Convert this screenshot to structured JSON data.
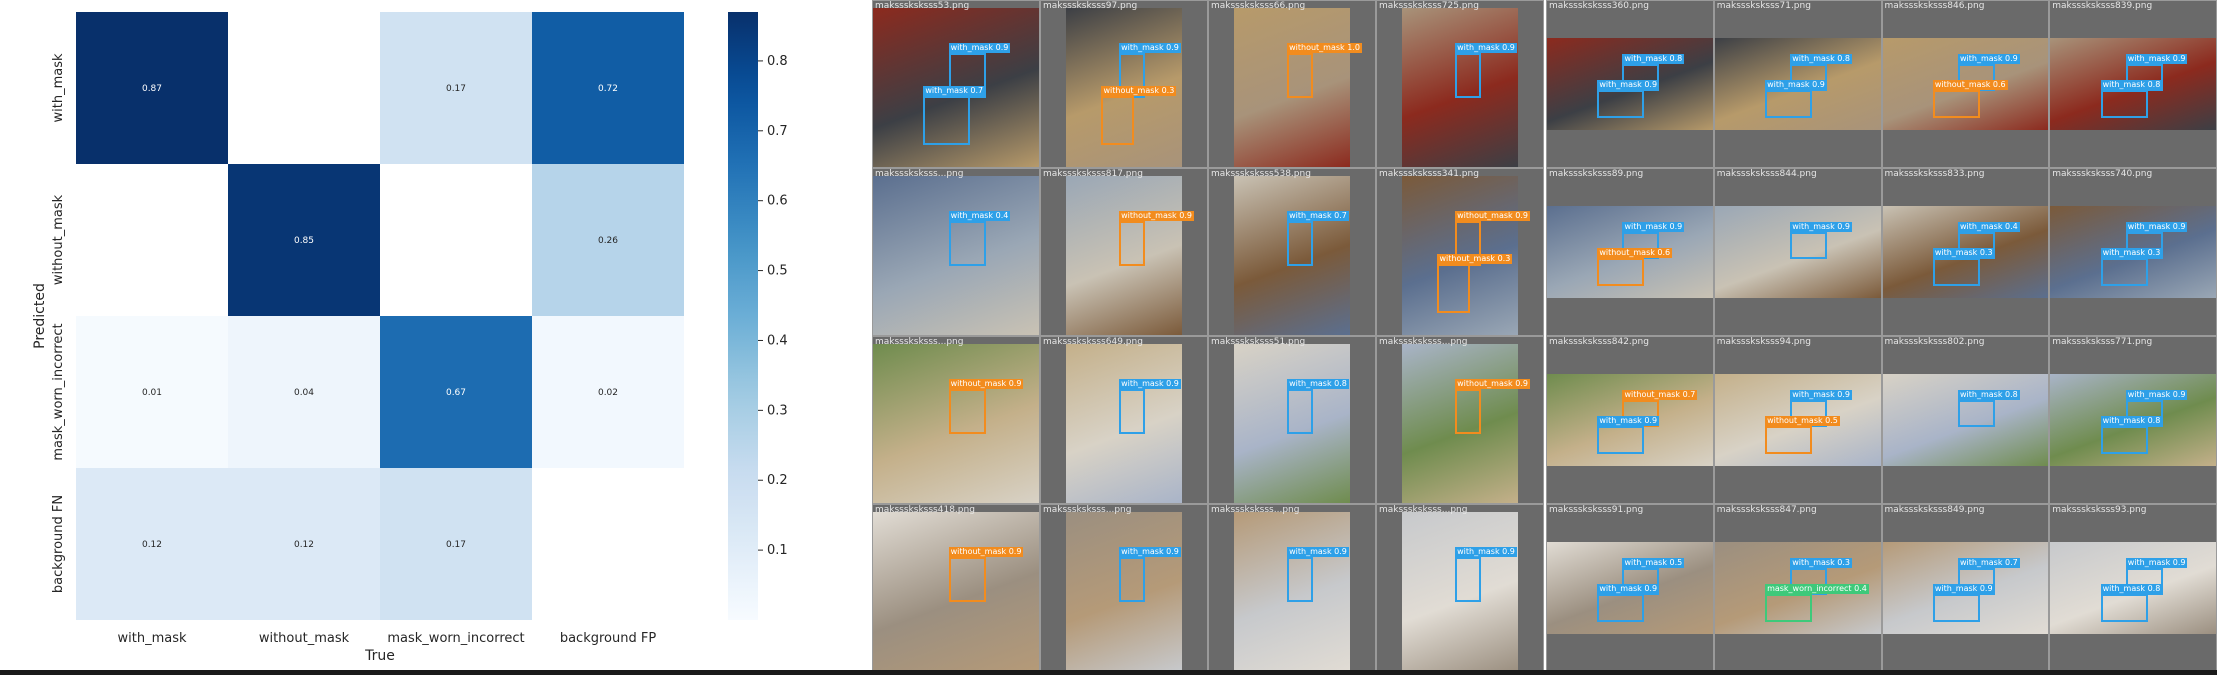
{
  "chart_data": {
    "type": "heatmap",
    "xlabel": "True",
    "ylabel": "Predicted",
    "x_categories": [
      "with_mask",
      "without_mask",
      "mask_worn_incorrect",
      "background FP"
    ],
    "y_categories": [
      "with_mask",
      "without_mask",
      "mask_worn_incorrect",
      "background FN"
    ],
    "matrix": [
      [
        0.87,
        null,
        0.17,
        0.72
      ],
      [
        null,
        0.85,
        null,
        0.26
      ],
      [
        0.01,
        0.04,
        0.67,
        0.02
      ],
      [
        0.12,
        0.12,
        0.17,
        null
      ]
    ],
    "colormap": "Blues",
    "colorbar": {
      "range": [
        0,
        0.87
      ],
      "ticks": [
        0.1,
        0.2,
        0.3,
        0.4,
        0.5,
        0.6,
        0.7,
        0.8
      ]
    },
    "grid": false
  },
  "mosaics": [
    {
      "grid_size": 4,
      "tiles": [
        {
          "name": "maksssksksss53.png",
          "boxes": [
            {
              "label": "with_mask 0.9",
              "cls": "with_mask"
            },
            {
              "label": "with_mask 0.7",
              "cls": "with_mask"
            }
          ]
        },
        {
          "name": "maksssksksss97.png",
          "boxes": [
            {
              "label": "with_mask 0.9",
              "cls": "with_mask"
            },
            {
              "label": "without_mask 0.3",
              "cls": "without_mask"
            }
          ]
        },
        {
          "name": "maksssksksss66.png",
          "boxes": [
            {
              "label": "without_mask 1.0",
              "cls": "without_mask"
            }
          ]
        },
        {
          "name": "maksssksksss725.png",
          "boxes": [
            {
              "label": "with_mask 0.9",
              "cls": "with_mask"
            }
          ]
        },
        {
          "name": "maksssksksss...png",
          "boxes": [
            {
              "label": "with_mask 0.4",
              "cls": "with_mask"
            }
          ]
        },
        {
          "name": "maksssksksss817.png",
          "boxes": [
            {
              "label": "without_mask 0.9",
              "cls": "without_mask"
            }
          ]
        },
        {
          "name": "maksssksksss538.png",
          "boxes": [
            {
              "label": "with_mask 0.7",
              "cls": "with_mask"
            }
          ]
        },
        {
          "name": "maksssksksss341.png",
          "boxes": [
            {
              "label": "without_mask 0.9",
              "cls": "without_mask"
            },
            {
              "label": "without_mask 0.3",
              "cls": "without_mask"
            }
          ]
        },
        {
          "name": "maksssksksss...png",
          "boxes": [
            {
              "label": "without_mask 0.9",
              "cls": "without_mask"
            }
          ]
        },
        {
          "name": "maksssksksss649.png",
          "boxes": [
            {
              "label": "with_mask 0.9",
              "cls": "with_mask"
            }
          ]
        },
        {
          "name": "maksssksksss51.png",
          "boxes": [
            {
              "label": "with_mask 0.8",
              "cls": "with_mask"
            }
          ]
        },
        {
          "name": "maksssksksss...png",
          "boxes": [
            {
              "label": "without_mask 0.9",
              "cls": "without_mask"
            }
          ]
        },
        {
          "name": "maksssksksss418.png",
          "boxes": [
            {
              "label": "without_mask 0.9",
              "cls": "without_mask"
            }
          ]
        },
        {
          "name": "maksssksksss...png",
          "boxes": [
            {
              "label": "with_mask 0.9",
              "cls": "with_mask"
            }
          ]
        },
        {
          "name": "maksssksksss...png",
          "boxes": [
            {
              "label": "with_mask 0.9",
              "cls": "with_mask"
            }
          ]
        },
        {
          "name": "maksssksksss...png",
          "boxes": [
            {
              "label": "with_mask 0.9",
              "cls": "with_mask"
            }
          ]
        }
      ]
    },
    {
      "grid_size": 4,
      "tiles": [
        {
          "name": "maksssksksss360.png",
          "boxes": [
            {
              "label": "with_mask 0.8",
              "cls": "with_mask"
            },
            {
              "label": "with_mask 0.9",
              "cls": "with_mask"
            }
          ]
        },
        {
          "name": "maksssksksss71.png",
          "boxes": [
            {
              "label": "with_mask 0.8",
              "cls": "with_mask"
            },
            {
              "label": "with_mask 0.9",
              "cls": "with_mask"
            }
          ]
        },
        {
          "name": "maksssksksss846.png",
          "boxes": [
            {
              "label": "with_mask 0.9",
              "cls": "with_mask"
            },
            {
              "label": "without_mask 0.6",
              "cls": "without_mask"
            }
          ]
        },
        {
          "name": "maksssksksss839.png",
          "boxes": [
            {
              "label": "with_mask 0.9",
              "cls": "with_mask"
            },
            {
              "label": "with_mask 0.8",
              "cls": "with_mask"
            }
          ]
        },
        {
          "name": "maksssksksss89.png",
          "boxes": [
            {
              "label": "with_mask 0.9",
              "cls": "with_mask"
            },
            {
              "label": "without_mask 0.6",
              "cls": "without_mask"
            }
          ]
        },
        {
          "name": "maksssksksss844.png",
          "boxes": [
            {
              "label": "with_mask 0.9",
              "cls": "with_mask"
            }
          ]
        },
        {
          "name": "maksssksksss833.png",
          "boxes": [
            {
              "label": "with_mask 0.4",
              "cls": "with_mask"
            },
            {
              "label": "with_mask 0.3",
              "cls": "with_mask"
            }
          ]
        },
        {
          "name": "maksssksksss740.png",
          "boxes": [
            {
              "label": "with_mask 0.9",
              "cls": "with_mask"
            },
            {
              "label": "with_mask 0.3",
              "cls": "with_mask"
            }
          ]
        },
        {
          "name": "maksssksksss842.png",
          "boxes": [
            {
              "label": "without_mask 0.7",
              "cls": "without_mask"
            },
            {
              "label": "with_mask 0.9",
              "cls": "with_mask"
            }
          ]
        },
        {
          "name": "maksssksksss94.png",
          "boxes": [
            {
              "label": "with_mask 0.9",
              "cls": "with_mask"
            },
            {
              "label": "without_mask 0.5",
              "cls": "without_mask"
            }
          ]
        },
        {
          "name": "maksssksksss802.png",
          "boxes": [
            {
              "label": "with_mask 0.8",
              "cls": "with_mask"
            }
          ]
        },
        {
          "name": "maksssksksss771.png",
          "boxes": [
            {
              "label": "with_mask 0.9",
              "cls": "with_mask"
            },
            {
              "label": "with_mask 0.8",
              "cls": "with_mask"
            }
          ]
        },
        {
          "name": "maksssksksss91.png",
          "boxes": [
            {
              "label": "with_mask 0.5",
              "cls": "with_mask"
            },
            {
              "label": "with_mask 0.9",
              "cls": "with_mask"
            }
          ]
        },
        {
          "name": "maksssksksss847.png",
          "boxes": [
            {
              "label": "with_mask 0.3",
              "cls": "with_mask"
            },
            {
              "label": "mask_worn_incorrect 0.4",
              "cls": "mask_worn_incorrect"
            }
          ]
        },
        {
          "name": "maksssksksss849.png",
          "boxes": [
            {
              "label": "with_mask 0.7",
              "cls": "with_mask"
            },
            {
              "label": "with_mask 0.9",
              "cls": "with_mask"
            }
          ]
        },
        {
          "name": "maksssksksss93.png",
          "boxes": [
            {
              "label": "with_mask 0.9",
              "cls": "with_mask"
            },
            {
              "label": "with_mask 0.8",
              "cls": "with_mask"
            }
          ]
        }
      ]
    }
  ],
  "class_colors": {
    "with_mask": "#2ea0e8",
    "without_mask": "#f28c1e",
    "mask_worn_incorrect": "#3ec97a"
  }
}
